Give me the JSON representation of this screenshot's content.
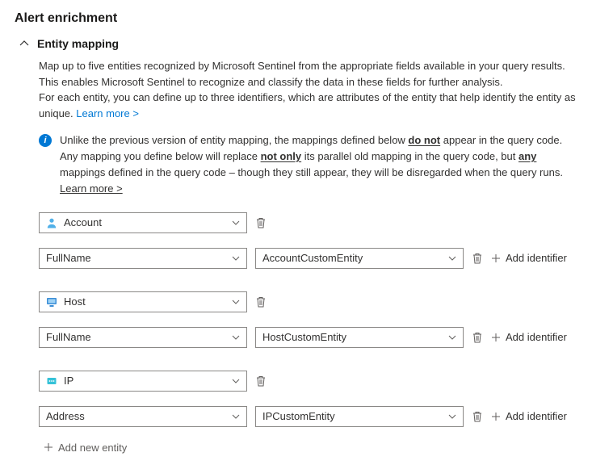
{
  "header": {
    "title": "Alert enrichment"
  },
  "section": {
    "title": "Entity mapping"
  },
  "description": {
    "line1": "Map up to five entities recognized by Microsoft Sentinel from the appropriate fields available in your query results.",
    "line2": "This enables Microsoft Sentinel to recognize and classify the data in these fields for further analysis.",
    "line3": "For each entity, you can define up to three identifiers, which are attributes of the entity that help identify the entity as unique. ",
    "learn_more": "Learn more >"
  },
  "info": {
    "t1": "Unlike the previous version of entity mapping, the mappings defined below ",
    "bold_u1": "do not",
    "t2": " appear in the query code. Any mapping you define below will replace ",
    "bold_u2": "not only",
    "t3": " its parallel old mapping in the query code, but ",
    "bold_u3": "any",
    "t4": " mappings defined in the query code – though they still appear, they will be disregarded when the query runs. ",
    "learn_more": "Learn more >"
  },
  "labels": {
    "add_identifier": "Add identifier",
    "add_entity": "Add new entity"
  },
  "entities": [
    {
      "entity_type": "Account",
      "icon": "account",
      "identifier": "FullName",
      "field": "AccountCustomEntity"
    },
    {
      "entity_type": "Host",
      "icon": "host",
      "identifier": "FullName",
      "field": "HostCustomEntity"
    },
    {
      "entity_type": "IP",
      "icon": "ip",
      "identifier": "Address",
      "field": "IPCustomEntity"
    }
  ]
}
